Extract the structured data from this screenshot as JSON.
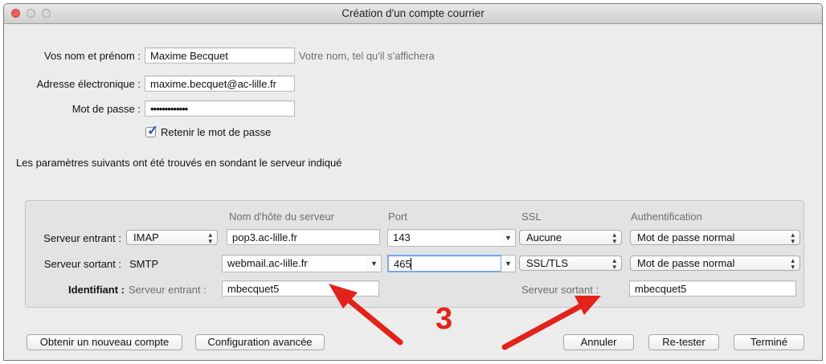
{
  "window": {
    "title": "Création d'un compte courrier"
  },
  "form": {
    "name_label": "Vos nom et prénom :",
    "name_value": "Maxime Becquet",
    "name_hint": "Votre nom, tel qu'il s'affichera",
    "email_label": "Adresse électronique :",
    "email_value": "maxime.becquet@ac-lille.fr",
    "password_label": "Mot de passe :",
    "password_value": "•••••••••••••",
    "remember_label": "Retenir le mot de passe",
    "remember_checked": true,
    "info_text": "Les paramètres suivants ont été trouvés en sondant le serveur indiqué"
  },
  "servers": {
    "headers": {
      "hostname": "Nom d'hôte du serveur",
      "port": "Port",
      "ssl": "SSL",
      "auth": "Authentification"
    },
    "incoming": {
      "label": "Serveur entrant :",
      "protocol": "IMAP",
      "hostname": "pop3.ac-lille.fr",
      "port": "143",
      "ssl": "Aucune",
      "auth": "Mot de passe normal"
    },
    "outgoing": {
      "label": "Serveur sortant :",
      "protocol": "SMTP",
      "hostname": "webmail.ac-lille.fr",
      "port": "465",
      "ssl": "SSL/TLS",
      "auth": "Mot de passe normal"
    },
    "identifier": {
      "label": "Identifiant :",
      "incoming_label": "Serveur entrant :",
      "incoming_value": "mbecquet5",
      "outgoing_label": "Serveur sortant :",
      "outgoing_value": "mbecquet5"
    }
  },
  "buttons": {
    "new_account": "Obtenir un nouveau compte",
    "advanced": "Configuration avancée",
    "cancel": "Annuler",
    "retest": "Re-tester",
    "done": "Terminé"
  },
  "annotation": {
    "step_number": "3",
    "color": "#e2231a"
  },
  "icons": {
    "popup": "updown-arrows-icon",
    "combo": "chevron-down-icon",
    "check": "checkmark-icon"
  }
}
